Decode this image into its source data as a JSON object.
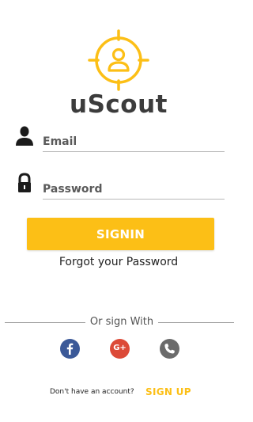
{
  "app": {
    "title": "uScout"
  },
  "colors": {
    "accent": "#fcbf16",
    "facebook": "#3b5998",
    "google": "#dc4a38",
    "phone": "#6b6b6b"
  },
  "form": {
    "email": {
      "placeholder": "Email",
      "icon": "user-icon"
    },
    "password": {
      "placeholder": "Password",
      "icon": "lock-icon"
    }
  },
  "actions": {
    "signin_label": "SIGNIN",
    "forgot_label": "Forgot your Password"
  },
  "social": {
    "divider_text": "Or sign With",
    "buttons": [
      {
        "name": "facebook",
        "icon": "facebook-icon",
        "glyph": "f"
      },
      {
        "name": "google",
        "icon": "google-plus-icon",
        "glyph": "G+"
      },
      {
        "name": "phone",
        "icon": "phone-icon"
      }
    ]
  },
  "signup": {
    "prompt": "Don't have an account?",
    "link_label": "SIGN UP"
  }
}
